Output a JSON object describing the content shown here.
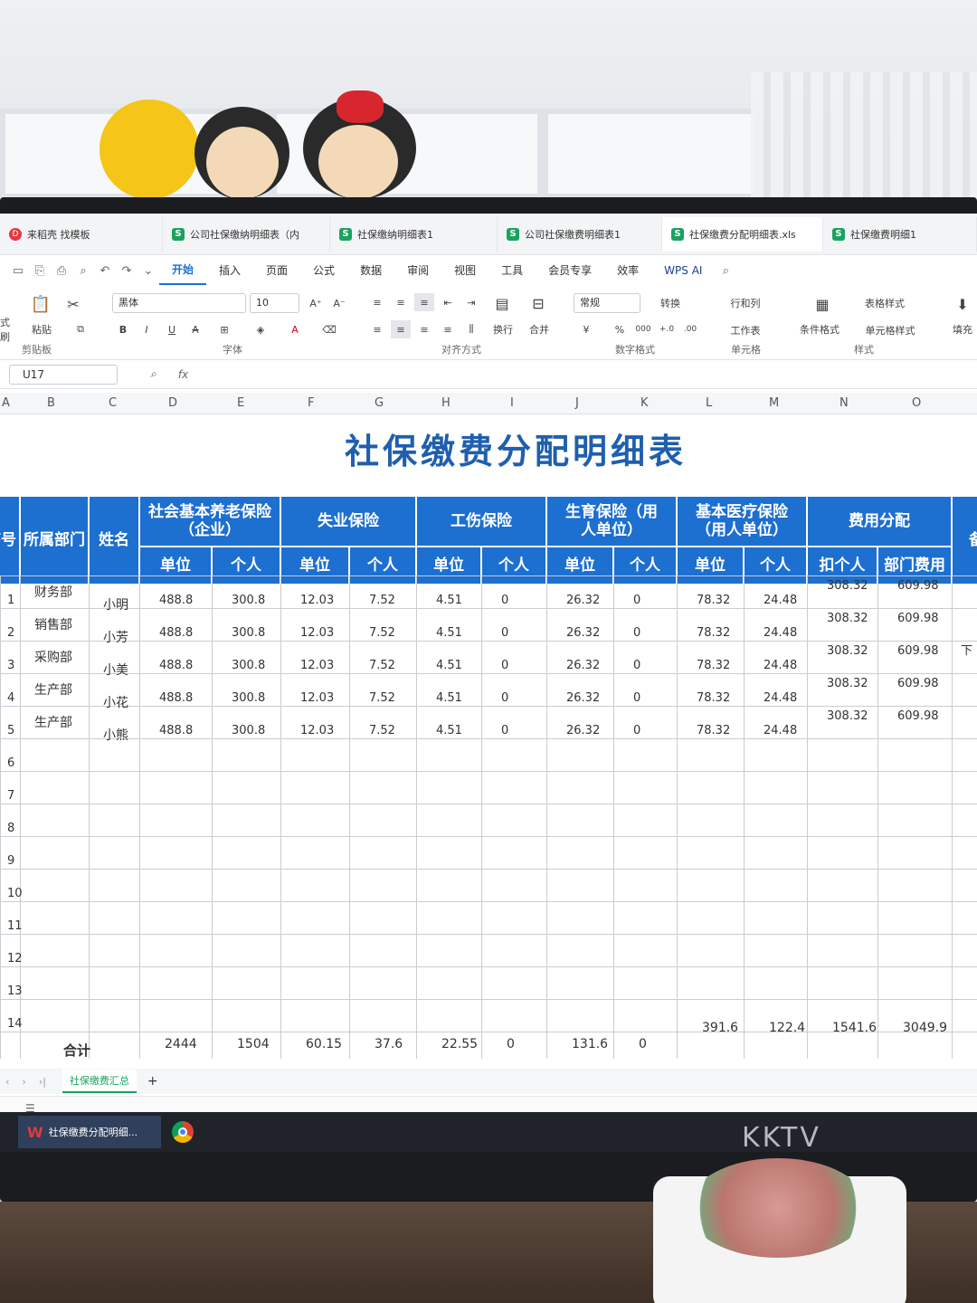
{
  "tabs": [
    {
      "label": "来稻壳 找模板",
      "icon": "docer-icon"
    },
    {
      "label": "公司社保缴纳明细表（内",
      "icon": "sheet-icon"
    },
    {
      "label": "社保缴纳明细表1",
      "icon": "sheet-icon"
    },
    {
      "label": "公司社保缴费明细表1",
      "icon": "sheet-icon"
    },
    {
      "label": "社保缴费分配明细表.xls",
      "icon": "sheet-icon"
    },
    {
      "label": "社保缴费明细1",
      "icon": "sheet-icon"
    }
  ],
  "menu": [
    "开始",
    "插入",
    "页面",
    "公式",
    "数据",
    "审阅",
    "视图",
    "工具",
    "会员专享",
    "效率",
    "WPS AI"
  ],
  "menu_active": "开始",
  "ribbon": {
    "paste": "粘贴",
    "brush": "式刷",
    "clipboard": "剪贴板",
    "font_name": "黑体",
    "font_size": "10",
    "font_group": "字体",
    "wrap": "换行",
    "merge": "合并",
    "align_group": "对齐方式",
    "number_format": "常规",
    "convert": "转换",
    "number_group": "数字格式",
    "row_col": "行和列",
    "worksheet": "工作表",
    "cell_group": "单元格",
    "cond_format": "条件格式",
    "table_style": "表格样式",
    "cell_style": "单元格样式",
    "style_group": "样式",
    "fill": "填充"
  },
  "formula_bar": {
    "cell_ref": "U17",
    "fx": "fx"
  },
  "columns": [
    "A",
    "B",
    "C",
    "D",
    "E",
    "F",
    "G",
    "H",
    "I",
    "J",
    "K",
    "L",
    "M",
    "N",
    "O"
  ],
  "sheet_title": "社保缴费分配明细表",
  "headers": {
    "seq": "序号",
    "dept": "所属部门",
    "name": "姓名",
    "pension": "社会基本养老保险（企业）",
    "unemployment": "失业保险",
    "injury": "工伤保险",
    "maternity": "生育保险（用人单位）",
    "medical": "基本医疗保险（用人单位）",
    "allocation": "费用分配",
    "remark": "备",
    "unit": "单位",
    "personal": "个人",
    "deduct_personal": "扣个人",
    "dept_cost": "部门费用"
  },
  "rows": [
    {
      "no": "1",
      "dept": "财务部",
      "name": "小明",
      "v": [
        "488.8",
        "300.8",
        "12.03",
        "7.52",
        "4.51",
        "0",
        "26.32",
        "0",
        "78.32",
        "24.48",
        "308.32",
        "609.98"
      ],
      "remark": ""
    },
    {
      "no": "2",
      "dept": "销售部",
      "name": "小芳",
      "v": [
        "488.8",
        "300.8",
        "12.03",
        "7.52",
        "4.51",
        "0",
        "26.32",
        "0",
        "78.32",
        "24.48",
        "308.32",
        "609.98"
      ],
      "remark": ""
    },
    {
      "no": "3",
      "dept": "采购部",
      "name": "小美",
      "v": [
        "488.8",
        "300.8",
        "12.03",
        "7.52",
        "4.51",
        "0",
        "26.32",
        "0",
        "78.32",
        "24.48",
        "308.32",
        "609.98"
      ],
      "remark": "下"
    },
    {
      "no": "4",
      "dept": "生产部",
      "name": "小花",
      "v": [
        "488.8",
        "300.8",
        "12.03",
        "7.52",
        "4.51",
        "0",
        "26.32",
        "0",
        "78.32",
        "24.48",
        "308.32",
        "609.98"
      ],
      "remark": ""
    },
    {
      "no": "5",
      "dept": "生产部",
      "name": "小熊",
      "v": [
        "488.8",
        "300.8",
        "12.03",
        "7.52",
        "4.51",
        "0",
        "26.32",
        "0",
        "78.32",
        "24.48",
        "308.32",
        "609.98"
      ],
      "remark": ""
    }
  ],
  "empty_rows": [
    "6",
    "7",
    "8",
    "9",
    "10",
    "11",
    "12",
    "13",
    "14"
  ],
  "total": {
    "label": "合计",
    "v": [
      "2444",
      "1504",
      "60.15",
      "37.6",
      "22.55",
      "0",
      "131.6",
      "0",
      "391.6",
      "122.4",
      "1541.6",
      "3049.9"
    ]
  },
  "sheet_tab": "社保缴费汇总",
  "add_sheet": "+",
  "taskbar_item": "社保缴费分配明细...",
  "monitor_brand": "KKTV"
}
